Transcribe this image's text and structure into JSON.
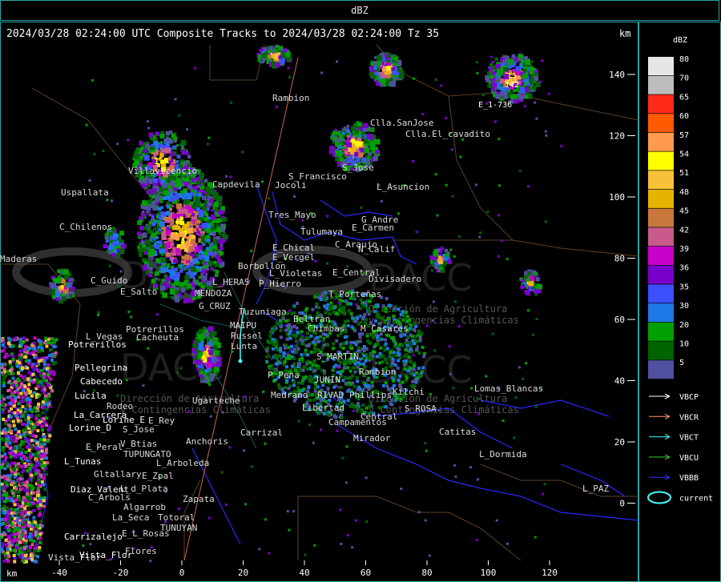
{
  "window": {
    "title": "dBZ"
  },
  "header": {
    "text": "2024/03/28 02:24:00 UTC Composite Tracks to 2024/03/28 02:24:00 Tz 35",
    "km_label": "km"
  },
  "axes": {
    "y_ticks": [
      "140",
      "120",
      "100",
      "80",
      "60",
      "40",
      "20",
      "0"
    ],
    "x_ticks": [
      "-40",
      "-20",
      "0",
      "20",
      "40",
      "60",
      "80",
      "100",
      "120"
    ],
    "x_unit": "km",
    "y_unit": "km"
  },
  "legend": {
    "title": "dBZ",
    "levels": [
      {
        "label": "80",
        "color": "#e6e6e6"
      },
      {
        "label": "70",
        "color": "#bdbdbd"
      },
      {
        "label": "65",
        "color": "#ff2a1a"
      },
      {
        "label": "60",
        "color": "#ff5a00"
      },
      {
        "label": "57",
        "color": "#ff9a50"
      },
      {
        "label": "54",
        "color": "#ffff00"
      },
      {
        "label": "51",
        "color": "#f7c23a"
      },
      {
        "label": "48",
        "color": "#e6b400"
      },
      {
        "label": "45",
        "color": "#c8783c"
      },
      {
        "label": "42",
        "color": "#c85a8c"
      },
      {
        "label": "39",
        "color": "#c800c8"
      },
      {
        "label": "36",
        "color": "#7800c8"
      },
      {
        "label": "35",
        "color": "#3c50ff"
      },
      {
        "label": "30",
        "color": "#1e78e6"
      },
      {
        "label": "20",
        "color": "#00a000"
      },
      {
        "label": "10",
        "color": "#006400"
      },
      {
        "label": "5",
        "color": "#5050a0"
      }
    ],
    "tracks": [
      {
        "label": "VBCP",
        "color": "#ffffff"
      },
      {
        "label": "VBCR",
        "color": "#ff9a70"
      },
      {
        "label": "VBCT",
        "color": "#40ffff"
      },
      {
        "label": "VBCU",
        "color": "#30d030"
      },
      {
        "label": "VBBB",
        "color": "#3030ff"
      },
      {
        "label": "current",
        "color": "#40ffff"
      }
    ]
  },
  "watermark": {
    "brand": "DACC",
    "subtitle_1": "Dirección de Agricultura",
    "subtitle_2": "y Contingencias Climáticas"
  },
  "storm_labels": [
    "142",
    "E_1-736"
  ],
  "places_grey": [
    "Rambion",
    "Clla.SanJose",
    "Clla.El_cavadito",
    "S_Francisco",
    "S_Jose",
    "L_Asuncion",
    "Uspallata",
    "Villavicencio",
    "Capdevila",
    "Jocoli",
    "Tres_Mayo",
    "G_Andre",
    "Tulumaya",
    "E_Carmen",
    "C_Chilenos",
    "E_Chical",
    "E_Vergel",
    "C_Araujo",
    "N_Calif",
    "Borbollon",
    "E_Central",
    "L_Violetas",
    "P_Hierro",
    "L_HERAS",
    "C_Guido",
    "MENDOZA",
    "E_Salto",
    "G_CRUZ",
    "Tuzuniaga",
    "Divisadero",
    "T_Porteñas",
    "Potrerillos",
    "L_Vegas",
    "Cacheuta",
    "MAIPU",
    "Russel",
    "Lunta",
    "Beltran",
    "Chimbas",
    "M_Casares",
    "S_MARTIN",
    "Rambion",
    "P_Pena",
    "JUNIN",
    "Medrano",
    "RIVAD",
    "Phillips",
    "Kilchi",
    "Lomas_Blancas",
    "Rodeo",
    "E_Rey",
    "Ugarteche",
    "Libertad",
    "Campamentos",
    "S_ROSA",
    "Central",
    "Catitas",
    "Carrizal",
    "Mirador",
    "L_Dormida",
    "S_Jose",
    "Anchoris",
    "E_Peral",
    "V_Btias",
    "TUPUNGATO",
    "L_Arboleda",
    "Gltallary",
    "E_Zpal",
    "L_d_Plata",
    "C_Arbols",
    "Zapata",
    "Algarrob",
    "La_Seca",
    "Totoral",
    "E_L_Rosas",
    "TUNUYAN",
    "Flores",
    "Vista_Flor",
    "L_PAZ",
    "Maderas"
  ],
  "places_white": [
    "Potrerillos",
    "Pellegrina",
    "Cabecedo",
    "Lucila",
    "La_Carrera",
    "Lorine_D",
    "Lorine_E",
    "L_Tunas",
    "Diaz_Valent",
    "Carrizalejo",
    "Vista_Flor"
  ],
  "corner_km": "km"
}
